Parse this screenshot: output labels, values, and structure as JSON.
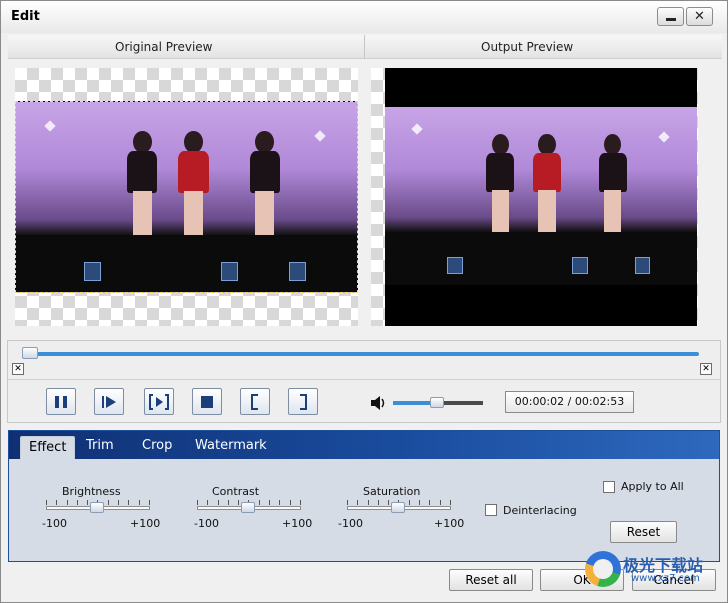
{
  "window": {
    "title": "Edit"
  },
  "preview": {
    "original_label": "Original Preview",
    "output_label": "Output Preview"
  },
  "playback": {
    "time_display": "00:00:02 / 00:02:53",
    "progress": 0.012,
    "volume": 0.5
  },
  "tabs": [
    {
      "label": "Effect",
      "active": true
    },
    {
      "label": "Trim"
    },
    {
      "label": "Crop"
    },
    {
      "label": "Watermark"
    }
  ],
  "effect": {
    "brightness": {
      "label": "Brightness",
      "min": "-100",
      "max": "+100",
      "value": 0
    },
    "contrast": {
      "label": "Contrast",
      "min": "-100",
      "max": "+100",
      "value": 0
    },
    "saturation": {
      "label": "Saturation",
      "min": "-100",
      "max": "+100",
      "value": 0
    },
    "deinterlacing_label": "Deinterlacing",
    "deinterlacing_checked": false,
    "apply_to_all_label": "Apply to All",
    "apply_to_all_checked": false,
    "reset_label": "Reset"
  },
  "footer": {
    "reset_all_label": "Reset all",
    "ok_label": "OK",
    "cancel_label": "Cancel"
  },
  "watermark_logo": {
    "text": "极光下载站",
    "url": "www.xz7.com"
  },
  "colors": {
    "accent": "#3b8fd7",
    "tab_strip": "#1a4c9e",
    "crop_border": "#f1e05a"
  }
}
